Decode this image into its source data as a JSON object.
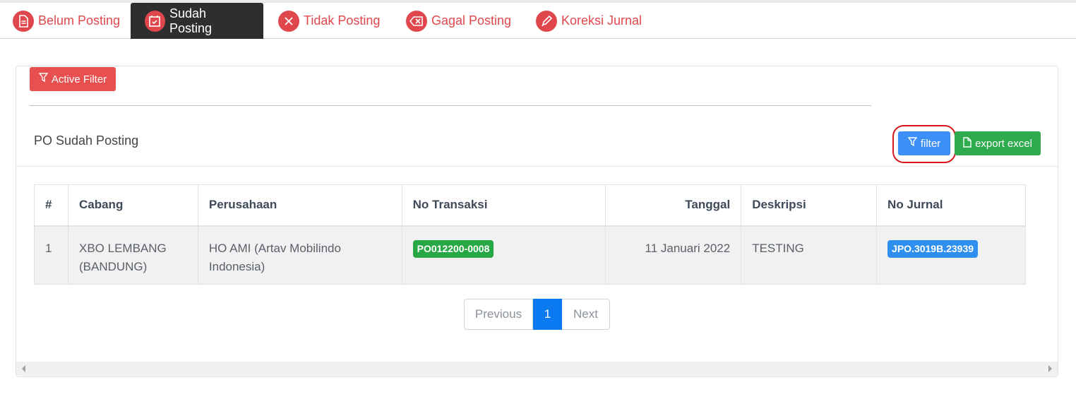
{
  "tabs": [
    {
      "label": "Belum Posting",
      "icon": "document-icon"
    },
    {
      "label": "Sudah Posting",
      "icon": "calendar-check-icon"
    },
    {
      "label": "Tidak Posting",
      "icon": "x-circle-icon"
    },
    {
      "label": "Gagal Posting",
      "icon": "backspace-icon"
    },
    {
      "label": "Koreksi Jurnal",
      "icon": "pencil-icon"
    }
  ],
  "active_tab": "Sudah Posting",
  "filter_bar": {
    "active_filter_label": "Active Filter"
  },
  "panel": {
    "title": "PO Sudah Posting",
    "filter_label": "filter",
    "export_label": "export excel"
  },
  "table": {
    "columns": [
      "#",
      "Cabang",
      "Perusahaan",
      "No Transaksi",
      "Tanggal",
      "Deskripsi",
      "No Jurnal"
    ],
    "rows": [
      {
        "no": "1",
        "cabang": "XBO LEMBANG (BANDUNG)",
        "perusahaan": "HO AMI (Artav Mobilindo Indonesia)",
        "no_transaksi": "PO012200-0008",
        "tanggal": "11 Januari 2022",
        "deskripsi": "TESTING",
        "no_jurnal": "JPO.3019B.23939"
      }
    ]
  },
  "pagination": {
    "previous": "Previous",
    "current": "1",
    "next": "Next"
  },
  "colors": {
    "accent_red": "#e0474c",
    "primary_blue": "#3d8ef5",
    "success_green": "#2eab4d",
    "active_tab_bg": "#2e2e2e"
  }
}
